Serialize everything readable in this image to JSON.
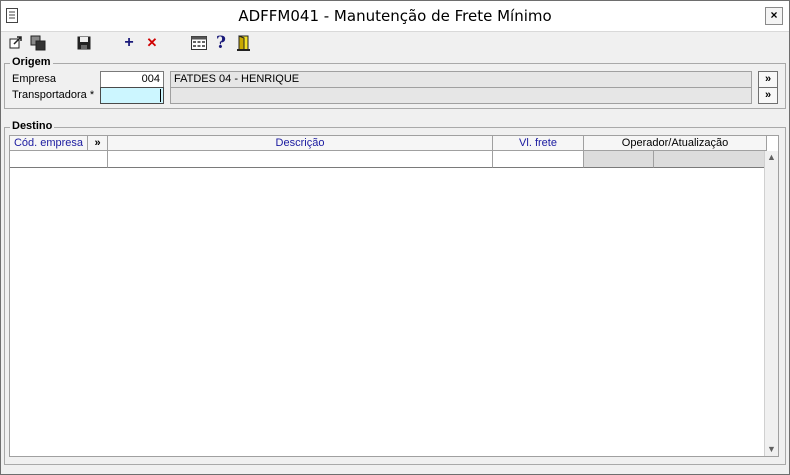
{
  "window": {
    "title": "ADFFM041 - Manutenção de Frete Mínimo",
    "close_label": "×"
  },
  "toolbar": {
    "items": [
      {
        "name": "exit-record-icon"
      },
      {
        "name": "copy-record-icon"
      },
      {
        "name": "save-icon"
      },
      {
        "name": "add-icon",
        "glyph": "+"
      },
      {
        "name": "delete-icon",
        "glyph": "✕"
      },
      {
        "name": "calculator-icon"
      },
      {
        "name": "help-icon",
        "glyph": "?"
      },
      {
        "name": "exit-door-icon"
      }
    ]
  },
  "origem": {
    "label": "Origem",
    "empresa_label": "Empresa",
    "empresa_value": "004",
    "empresa_desc": "FATDES 04 - HENRIQUE",
    "transportadora_label": "Transportadora *",
    "transportadora_value": "",
    "transportadora_desc": "",
    "select_glyph": "»"
  },
  "destino": {
    "label": "Destino",
    "columns": {
      "cod_empresa": "Cód. empresa",
      "select": "»",
      "descricao": "Descrição",
      "vl_frete": "Vl. frete",
      "operador": "Operador/Atualização"
    },
    "rows": [
      {
        "cod_empresa": "",
        "descricao": "",
        "vl_frete": "",
        "operador": "",
        "atualizacao": ""
      }
    ]
  },
  "colors": {
    "header_blue": "#1a1aa0",
    "input_active": "#ccf6ff",
    "readonly": "#e6e6e6"
  }
}
